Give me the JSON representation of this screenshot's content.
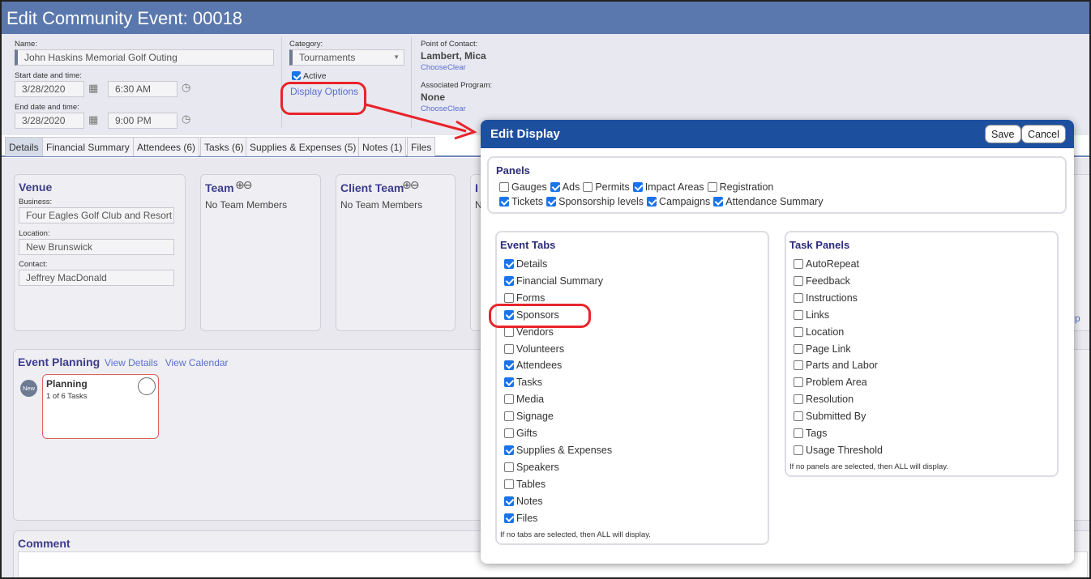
{
  "page": {
    "title": "Edit Community Event: 00018"
  },
  "header": {
    "name_label": "Name:",
    "name_value": "John Haskins Memorial Golf Outing",
    "start_label": "Start date and time:",
    "start_date": "3/28/2020",
    "start_time": "6:30 AM",
    "end_label": "End date and time:",
    "end_date": "3/28/2020",
    "end_time": "9:00 PM",
    "category_label": "Category:",
    "category_value": "Tournaments",
    "active_label": "Active",
    "display_options": "Display Options",
    "poc_label": "Point of Contact:",
    "poc_name": "Lambert, Mica",
    "poc_choose": "Choose",
    "poc_clear": "Clear",
    "program_label": "Associated Program:",
    "program_value": "None",
    "program_choose": "Choose",
    "program_clear": "Clear"
  },
  "tabs": [
    "Details",
    "Financial Summary",
    "Attendees (6)",
    "Tasks (6)",
    "Supplies & Expenses (5)",
    "Notes (1)",
    "Files"
  ],
  "venue": {
    "title": "Venue",
    "business_label": "Business:",
    "business_value": "Four Eagles Golf Club and Resort",
    "location_label": "Location:",
    "location_value": "New Brunswick",
    "contact_label": "Contact:",
    "contact_value": "Jeffrey MacDonald"
  },
  "team": {
    "title": "Team",
    "empty": "No Team Members"
  },
  "client_team": {
    "title": "Client Team",
    "empty": "No Team Members"
  },
  "cut": {
    "title_fragment": "I",
    "text_fragment": "N",
    "side_fragment": "p"
  },
  "planning": {
    "title": "Event Planning",
    "view_details": "View Details",
    "view_calendar": "View Calendar",
    "badge": "New",
    "card_title": "Planning",
    "card_sub": "1 of 6 Tasks"
  },
  "comment": {
    "title": "Comment"
  },
  "modal": {
    "title": "Edit Display",
    "save": "Save",
    "cancel": "Cancel",
    "panels_title": "Panels",
    "panels_row1": [
      {
        "label": "Gauges",
        "checked": false
      },
      {
        "label": "Ads",
        "checked": true
      },
      {
        "label": "Permits",
        "checked": false
      },
      {
        "label": "Impact Areas",
        "checked": true
      },
      {
        "label": "Registration",
        "checked": false
      }
    ],
    "panels_row2": [
      {
        "label": "Tickets",
        "checked": true
      },
      {
        "label": "Sponsorship levels",
        "checked": true
      },
      {
        "label": "Campaigns",
        "checked": true
      },
      {
        "label": "Attendance Summary",
        "checked": true
      }
    ],
    "event_tabs_title": "Event Tabs",
    "event_tabs": [
      {
        "label": "Details",
        "checked": true
      },
      {
        "label": "Financial Summary",
        "checked": true
      },
      {
        "label": "Forms",
        "checked": false
      },
      {
        "label": "Sponsors",
        "checked": true
      },
      {
        "label": "Vendors",
        "checked": false
      },
      {
        "label": "Volunteers",
        "checked": false
      },
      {
        "label": "Attendees",
        "checked": true
      },
      {
        "label": "Tasks",
        "checked": true
      },
      {
        "label": "Media",
        "checked": false
      },
      {
        "label": "Signage",
        "checked": false
      },
      {
        "label": "Gifts",
        "checked": false
      },
      {
        "label": "Supplies & Expenses",
        "checked": true
      },
      {
        "label": "Speakers",
        "checked": false
      },
      {
        "label": "Tables",
        "checked": false
      },
      {
        "label": "Notes",
        "checked": true
      },
      {
        "label": "Files",
        "checked": true
      }
    ],
    "event_tabs_note": "If no tabs are selected, then ALL will display.",
    "task_panels_title": "Task Panels",
    "task_panels": [
      {
        "label": "AutoRepeat",
        "checked": false
      },
      {
        "label": "Feedback",
        "checked": false
      },
      {
        "label": "Instructions",
        "checked": false
      },
      {
        "label": "Links",
        "checked": false
      },
      {
        "label": "Location",
        "checked": false
      },
      {
        "label": "Page Link",
        "checked": false
      },
      {
        "label": "Parts and Labor",
        "checked": false
      },
      {
        "label": "Problem Area",
        "checked": false
      },
      {
        "label": "Resolution",
        "checked": false
      },
      {
        "label": "Submitted By",
        "checked": false
      },
      {
        "label": "Tags",
        "checked": false
      },
      {
        "label": "Usage Threshold",
        "checked": false
      }
    ],
    "task_panels_note": "If no panels are selected, then ALL will display."
  },
  "colors": {
    "title_bar": "#5a78ad",
    "modal_header": "#1d4f9f",
    "accent": "#1a73e8",
    "highlight": "#e8242a"
  }
}
